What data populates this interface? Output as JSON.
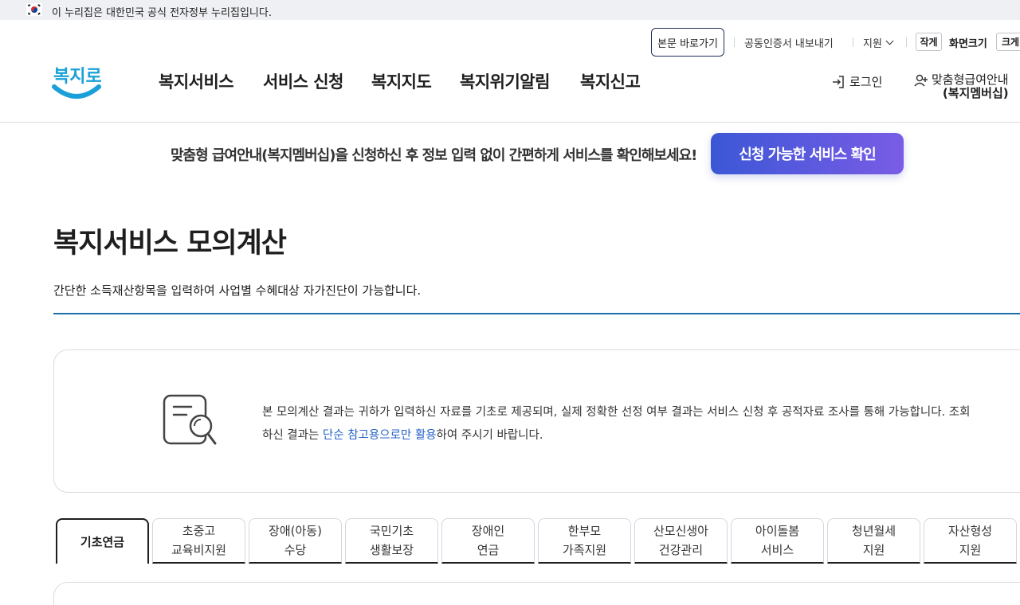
{
  "gov_banner": {
    "text": "이 누리집은 대한민국 공식 전자정부 누리집입니다."
  },
  "utility": {
    "skip_label": "본문 바로가기",
    "cert_label": "공동인증서 내보내기",
    "support_label": "지원",
    "size_small": "작게",
    "size_label": "화면크기",
    "size_large": "크게"
  },
  "logo": {
    "text": "복지로"
  },
  "gnb": [
    "복지서비스",
    "서비스 신청",
    "복지지도",
    "복지위기알림",
    "복지신고"
  ],
  "account": {
    "login_label": "로그인",
    "member_line1": "맞춤형급여안내",
    "member_line2": "(복지멤버십)"
  },
  "promo": {
    "text": "맞춤형 급여안내(복지멤버십)을 신청하신 후 정보 입력 없이 간편하게 서비스를 확인해보세요!",
    "button": "신청 가능한 서비스 확인"
  },
  "page": {
    "title": "복지서비스 모의계산",
    "description": "간단한 소득재산항목을 입력하여 사업별 수혜대상 자가진단이 가능합니다."
  },
  "notice": {
    "text_before": "본 모의계산 결과는 귀하가 입력하신 자료를 기초로 제공되며, 실제 정확한 선정 여부 결과는 서비스 신청 후 공적자료 조사를 통해 가능합니다. 조회하신 결과는 ",
    "link_text": "단순 참고용으로만 활용",
    "text_after": "하여 주시기 바랍니다."
  },
  "tabs": [
    {
      "label": "기초연금",
      "active": true
    },
    {
      "label": "초중고\n교육비지원",
      "active": false
    },
    {
      "label": "장애(아동)\n수당",
      "active": false
    },
    {
      "label": "국민기초\n생활보장",
      "active": false
    },
    {
      "label": "장애인\n연금",
      "active": false
    },
    {
      "label": "한부모\n가족지원",
      "active": false
    },
    {
      "label": "산모신생아\n건강관리",
      "active": false
    },
    {
      "label": "아이돌봄\n서비스",
      "active": false
    },
    {
      "label": "청년월세\n지원",
      "active": false
    },
    {
      "label": "자산형성\n지원",
      "active": false
    }
  ],
  "colors": {
    "accent": "#3b57d6",
    "link": "#2563c8",
    "title_line": "#1a6fa8",
    "logo": "#1aa0d8"
  }
}
